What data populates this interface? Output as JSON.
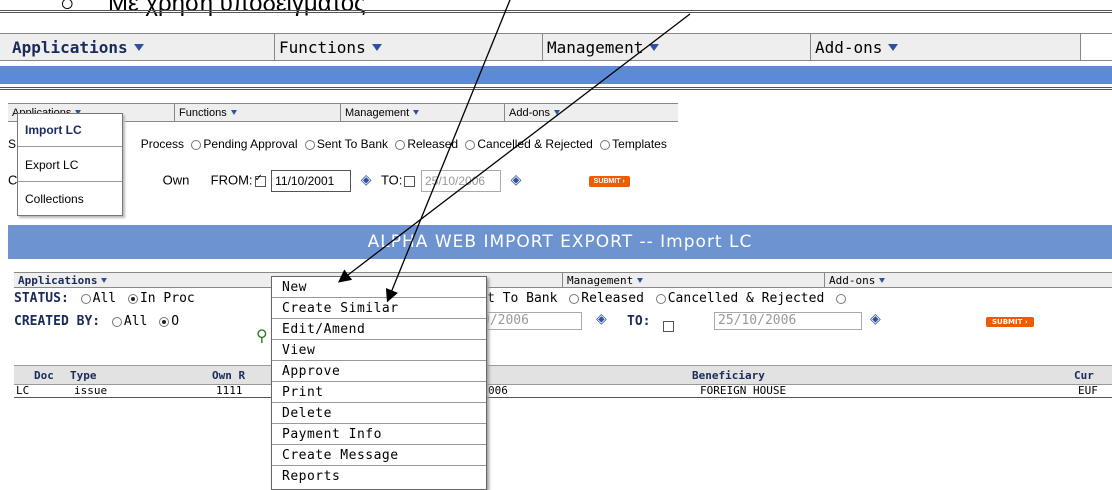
{
  "top_heading": "Με χρήση υποδείγματος",
  "nav_large": {
    "items": [
      {
        "label": "Applications",
        "bold": true
      },
      {
        "label": "Functions"
      },
      {
        "label": "Management"
      },
      {
        "label": "Add-ons"
      }
    ]
  },
  "nav_mid": {
    "items": [
      {
        "label": "Applications"
      },
      {
        "label": "Functions"
      },
      {
        "label": "Management"
      },
      {
        "label": "Add-ons"
      }
    ]
  },
  "side_menu": {
    "items": [
      "Import LC",
      "Export LC",
      "Collections"
    ]
  },
  "status_row_1": {
    "prefix": "S",
    "options": [
      {
        "label": "Process",
        "selected": false
      },
      {
        "label": "Pending Approval",
        "selected": false
      },
      {
        "label": "Sent To Bank",
        "selected": false
      },
      {
        "label": "Released",
        "selected": false
      },
      {
        "label": "Cancelled & Rejected",
        "selected": false
      },
      {
        "label": "Templates",
        "selected": false
      }
    ]
  },
  "created_row_1": {
    "prefix": "C",
    "own_label": "Own",
    "from_label": "FROM:",
    "from_value": "11/10/2001",
    "to_label": "TO:",
    "to_value": "25/10/2006",
    "submit": "SUBMIT ›"
  },
  "title_banner": "ALPHA WEB IMPORT EXPORT --  Import LC",
  "nav_small": {
    "items": [
      {
        "label": "Applications"
      },
      {
        "label": "Management"
      },
      {
        "label": "Add-ons"
      }
    ]
  },
  "status_row_2": {
    "label": "STATUS:",
    "all": "All",
    "in_proc": "In Proc",
    "tail_options": [
      "oval",
      "Sent To Bank",
      "Released",
      "Cancelled & Rejected"
    ]
  },
  "created_row_2": {
    "label": "CREATED BY:",
    "all": "All",
    "own_prefix": "O",
    "from_value_partial": "0/2006",
    "to_label": "TO:",
    "to_value": "25/10/2006",
    "submit": "SUBMIT ›"
  },
  "table": {
    "headers": [
      "Doc",
      "Type",
      "Own R",
      "te",
      "Beneficiary",
      "Cur"
    ],
    "rows": [
      {
        "doc": "LC",
        "type": "issue",
        "own": "1111",
        "date": "006",
        "beneficiary": "FOREIGN HOUSE",
        "cur": "EUF"
      }
    ]
  },
  "context_menu": {
    "items": [
      "New",
      "Create Similar",
      "Edit/Amend",
      "View",
      "Approve",
      "Print",
      "Delete",
      "Payment Info",
      "Create Message",
      "Reports"
    ]
  },
  "colors": {
    "nav_blue": "#3050a0",
    "banner_blue": "#5c8ad6",
    "title_banner": "#6d93d0",
    "submit_orange": "#f05a00"
  }
}
